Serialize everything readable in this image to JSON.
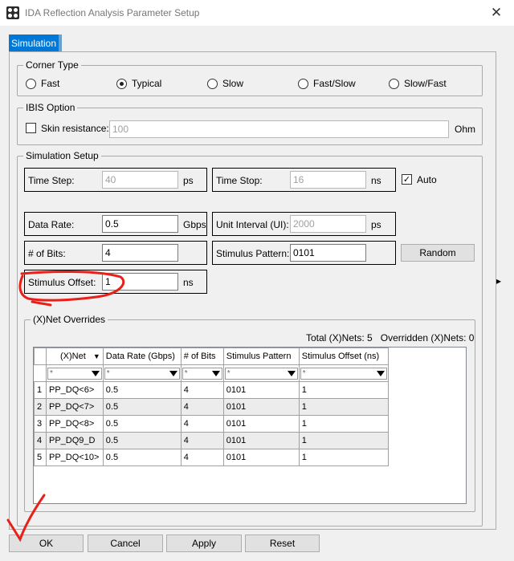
{
  "window": {
    "title": "IDA Reflection Analysis Parameter Setup",
    "close_glyph": "✕"
  },
  "tabs": [
    "Simulation"
  ],
  "corner_type": {
    "legend": "Corner Type",
    "options": [
      "Fast",
      "Typical",
      "Slow",
      "Fast/Slow",
      "Slow/Fast"
    ],
    "selected": "Typical"
  },
  "ibis": {
    "legend": "IBIS Option",
    "skin_label": "Skin resistance:",
    "skin_checked": false,
    "skin_value": "100",
    "unit": "Ohm"
  },
  "sim_setup": {
    "legend": "Simulation Setup",
    "time_step": {
      "label": "Time Step:",
      "value": "40",
      "unit": "ps"
    },
    "time_stop": {
      "label": "Time Stop:",
      "value": "16",
      "unit": "ns"
    },
    "auto": {
      "label": "Auto",
      "checked": true,
      "check_glyph": "✓"
    },
    "data_rate": {
      "label": "Data Rate:",
      "value": "0.5",
      "unit": "Gbps"
    },
    "unit_interval": {
      "label": "Unit Interval (UI):",
      "value": "2000",
      "unit": "ps"
    },
    "num_bits": {
      "label": "# of Bits:",
      "value": "4"
    },
    "stim_pattern": {
      "label": "Stimulus Pattern:",
      "value": "0101"
    },
    "random_label": "Random",
    "stim_offset": {
      "label": "Stimulus Offset:",
      "value": "1",
      "unit": "ns"
    }
  },
  "net_overrides": {
    "legend": "(X)Net Overrides",
    "total_label": "Total (X)Nets:",
    "total": "5",
    "overridden_label": "Overridden (X)Nets:",
    "overridden": "0",
    "columns": [
      "(X)Net",
      "Data Rate (Gbps)",
      "# of Bits",
      "Stimulus Pattern",
      "Stimulus Offset (ns)"
    ],
    "filter_placeholder": "*",
    "rows": [
      [
        "1",
        "PP_DQ<6>",
        "0.5",
        "4",
        "0101",
        "1"
      ],
      [
        "2",
        "PP_DQ<7>",
        "0.5",
        "4",
        "0101",
        "1"
      ],
      [
        "3",
        "PP_DQ<8>",
        "0.5",
        "4",
        "0101",
        "1"
      ],
      [
        "4",
        "PP_DQ9_D",
        "0.5",
        "4",
        "0101",
        "1"
      ],
      [
        "5",
        "PP_DQ<10>",
        "0.5",
        "4",
        "0101",
        "1"
      ]
    ]
  },
  "buttons": {
    "ok": "OK",
    "cancel": "Cancel",
    "apply": "Apply",
    "reset": "Reset"
  },
  "side_arrow": "▸",
  "colors": {
    "accent": "#0078d7",
    "annotation": "#e8201a"
  }
}
